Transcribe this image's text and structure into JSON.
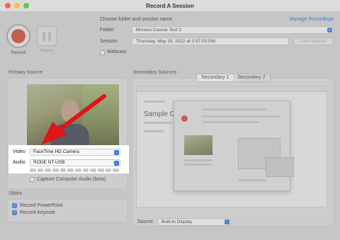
{
  "window": {
    "title": "Record A Session",
    "light_colors": [
      "#ee6a5e",
      "#f5bf4f",
      "#61c554"
    ]
  },
  "controls": {
    "record_label": "Record",
    "pause_label": "Pause"
  },
  "session": {
    "heading": "Choose folder and session name",
    "manage_link": "Manage Recordings",
    "folder_label": "Folder",
    "folder_value": "Moreno Course Test 3",
    "session_label": "Session",
    "session_value": "Thursday, May 19, 2022 at 2:57:03 PM",
    "join_label": "Join Session",
    "webcast_label": "Webcast",
    "webcast_checked": false
  },
  "primary": {
    "title": "Primary Source",
    "video_label": "Video",
    "video_value": "FaceTime HD Camera",
    "audio_label": "Audio",
    "audio_value": "RODE NT-USB",
    "capture_audio_label": "Capture Computer Audio (beta)",
    "capture_audio_checked": false
  },
  "slides": {
    "title": "Slides",
    "powerpoint_label": "Record PowerPoint",
    "keynote_label": "Record Keynote",
    "powerpoint_checked": true,
    "keynote_checked": true
  },
  "secondary": {
    "title": "Secondary Sources",
    "tabs": [
      "Secondary 1",
      "Secondary 2"
    ],
    "active_tab": 0,
    "preview_title": "Sample Course",
    "source_label": "Source",
    "source_value": "Built-in Display"
  },
  "annotation": {
    "arrow_color": "#e0141b"
  }
}
